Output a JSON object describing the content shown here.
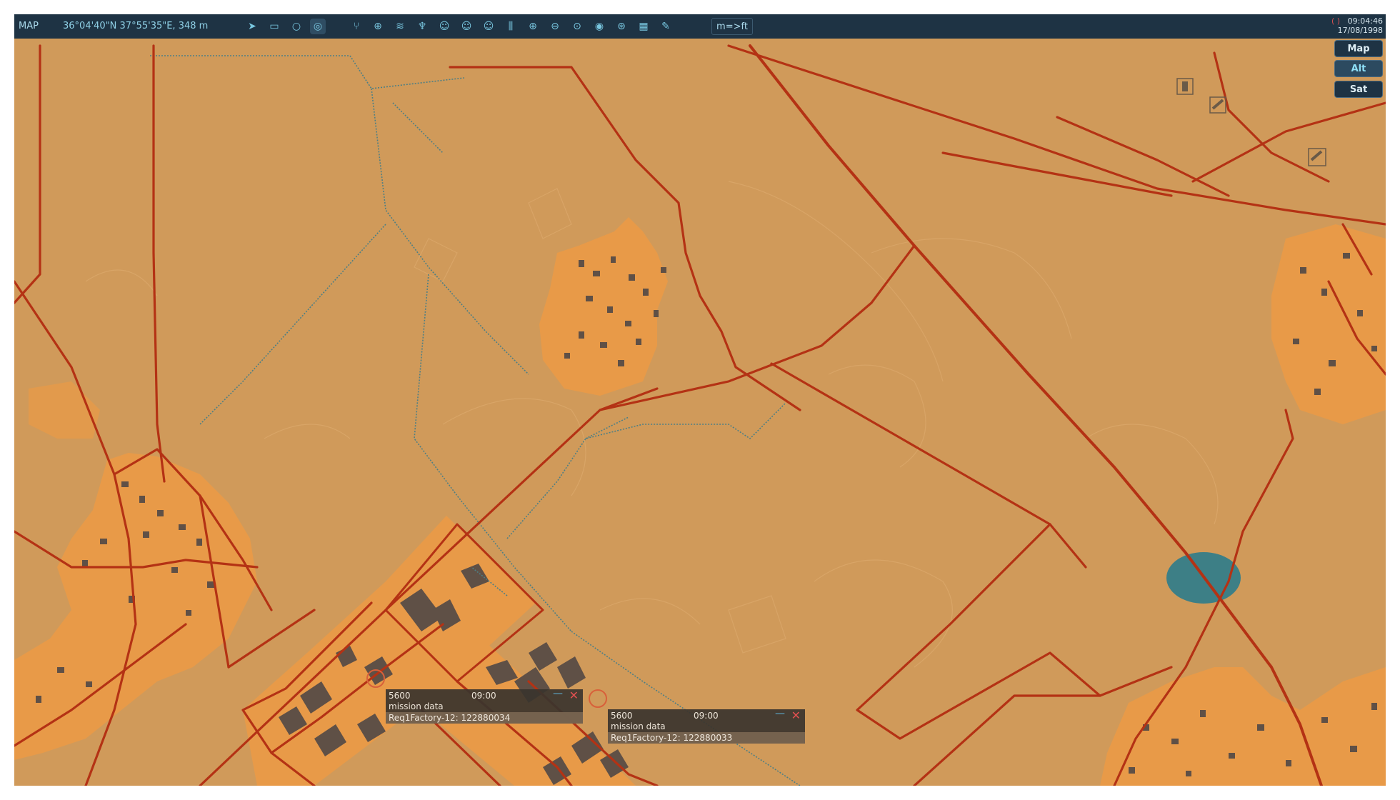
{
  "topbar": {
    "title": "MAP",
    "coordinates": "36°04'40\"N 37°55'35\"E, 348 m",
    "units_toggle": "m=>ft",
    "rec_indicator": "( )",
    "time": "09:04:46",
    "date": "17/08/1998",
    "tools": [
      {
        "name": "navigate-icon",
        "glyph": "➤"
      },
      {
        "name": "ruler-icon",
        "glyph": "▭"
      },
      {
        "name": "circle-icon",
        "glyph": "○"
      },
      {
        "name": "layers-icon",
        "glyph": "◎"
      },
      {
        "name": "route-icon",
        "glyph": "⑂"
      },
      {
        "name": "crosshair-icon",
        "glyph": "⊕"
      },
      {
        "name": "wifi-icon",
        "glyph": "≋"
      },
      {
        "name": "antenna-icon",
        "glyph": "♆"
      },
      {
        "name": "head-a-icon",
        "glyph": "☺"
      },
      {
        "name": "head-b-icon",
        "glyph": "☺"
      },
      {
        "name": "head-c-icon",
        "glyph": "☺"
      },
      {
        "name": "split-icon",
        "glyph": "⫼"
      },
      {
        "name": "zoom-in-icon",
        "glyph": "⊕"
      },
      {
        "name": "zoom-out-icon",
        "glyph": "⊖"
      },
      {
        "name": "zoom-fit-icon",
        "glyph": "⊙"
      },
      {
        "name": "target-icon",
        "glyph": "◉"
      },
      {
        "name": "globe-icon",
        "glyph": "⊛"
      },
      {
        "name": "grid-icon",
        "glyph": "▦"
      },
      {
        "name": "pen-icon",
        "glyph": "✎"
      }
    ]
  },
  "layers": {
    "map": "Map",
    "alt": "Alt",
    "sat": "Sat"
  },
  "popups": [
    {
      "altitude": "5600",
      "time": "09:00",
      "label": "mission data",
      "identifier": "Req1Factory-12: 122880034"
    },
    {
      "altitude": "5600",
      "time": "09:00",
      "label": "mission data",
      "identifier": "Req1Factory-12: 122880033"
    }
  ],
  "colors": {
    "terrain": "#d09a5a",
    "urban": "#e89a48",
    "road": "#b43214",
    "water": "#3d7f86",
    "building": "#5f5046",
    "topbar": "#1e3344"
  }
}
